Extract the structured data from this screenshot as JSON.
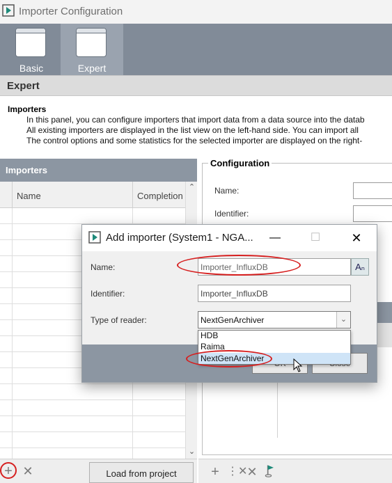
{
  "window": {
    "title": "Importer Configuration"
  },
  "view_buttons": [
    {
      "label": "Basic",
      "active": false
    },
    {
      "label": "Expert",
      "active": true
    }
  ],
  "section": {
    "title": "Expert"
  },
  "description": {
    "heading": "Importers",
    "lines": [
      "In this panel, you can configure importers that import data from a data source into the datab",
      "All existing importers are displayed in the list view on the left-hand side. You can import all",
      "The control options and some statistics for the selected importer are displayed on the right-"
    ]
  },
  "importers": {
    "header": "Importers",
    "columns": [
      "Name",
      "Completion"
    ],
    "load_button": "Load from project"
  },
  "configuration": {
    "legend": "Configuration",
    "labels": {
      "name": "Name:",
      "identifier": "Identifier:"
    }
  },
  "dialog": {
    "title": "Add importer (System1 - NGA...",
    "name_label": "Name:",
    "name_value": "Importer_InfluxDB",
    "identifier_label": "Identifier:",
    "identifier_value": "Importer_InfluxDB",
    "reader_label": "Type of reader:",
    "reader_value": "NextGenArchiver",
    "reader_options": [
      "HDB",
      "Raima",
      "NextGenArchiver"
    ],
    "ok_label": "OK",
    "close_label": "Close"
  },
  "colors": {
    "accent_header": "#8c96a2",
    "annotation_red": "#d61f1f",
    "selected_option": "#cfe4f7"
  }
}
